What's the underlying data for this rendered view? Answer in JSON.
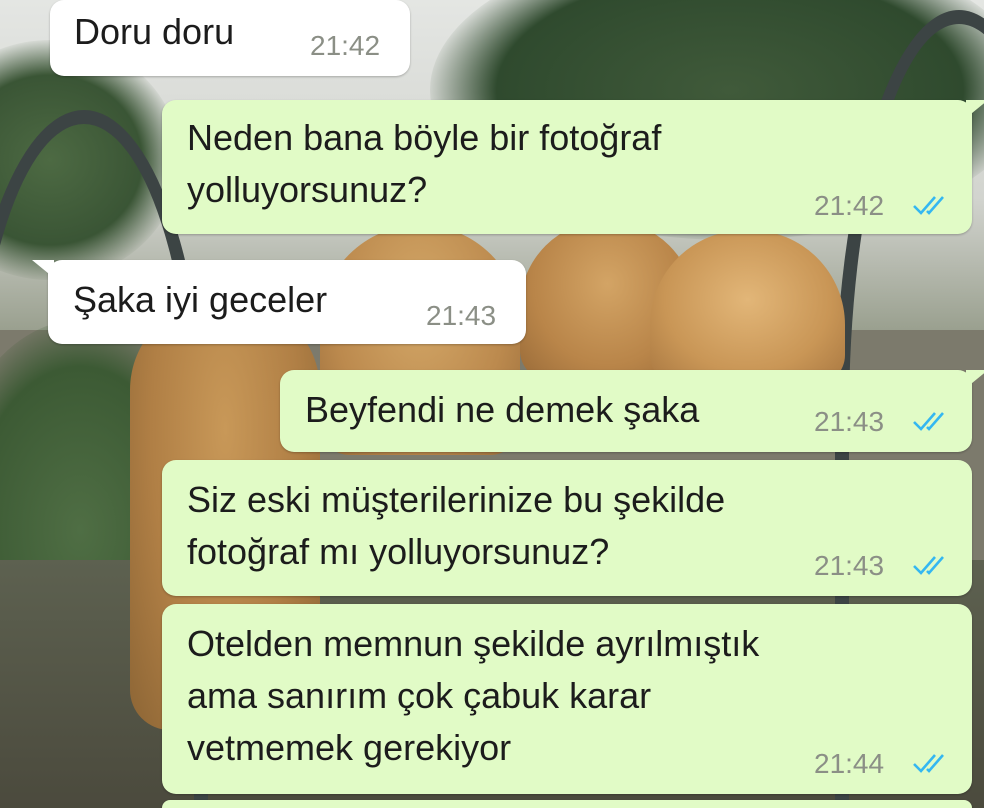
{
  "chat": {
    "messages": [
      {
        "direction": "incoming",
        "lines": [
          "Doru doru"
        ],
        "time": "21:42"
      },
      {
        "direction": "outgoing",
        "lines": [
          "Neden bana böyle bir fotoğraf",
          "yolluyorsunuz?"
        ],
        "time": "21:42",
        "status": "read"
      },
      {
        "direction": "incoming",
        "lines": [
          "Şaka iyi geceler"
        ],
        "time": "21:43"
      },
      {
        "direction": "outgoing",
        "lines": [
          "Beyfendi ne demek şaka"
        ],
        "time": "21:43",
        "status": "read"
      },
      {
        "direction": "outgoing",
        "lines": [
          "Siz eski müşterilerinize bu şekilde",
          "fotoğraf mı yolluyorsunuz?"
        ],
        "time": "21:43",
        "status": "read"
      },
      {
        "direction": "outgoing",
        "lines": [
          "Otelden memnun şekilde ayrılmıştık",
          "ama sanırım çok çabuk karar",
          "vetmemek gerekiyor"
        ],
        "time": "21:44",
        "status": "read"
      }
    ]
  },
  "colors": {
    "incoming_bubble": "#ffffff",
    "outgoing_bubble": "#e1fbc6",
    "read_ticks": "#34b7f1",
    "timestamp": "#8b8f86"
  },
  "icons": {
    "read_status": "double-check-icon"
  }
}
